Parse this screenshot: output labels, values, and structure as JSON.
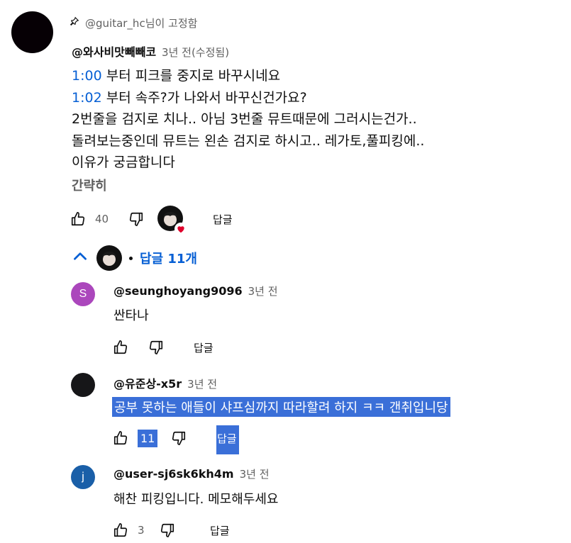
{
  "pinned": {
    "label": "@guitar_hc님이 고정함",
    "icon": "pin-icon"
  },
  "main_comment": {
    "author": "@와사비맛빼빼코",
    "time": "3년 전(수정됨)",
    "lines": [
      {
        "timestamp": "1:00",
        "text": " 부터 피크를 중지로 바꾸시네요"
      },
      {
        "timestamp": "1:02",
        "text": " 부터 속주?가 나와서 바꾸신건가요?"
      },
      {
        "timestamp": "",
        "text": "2번줄을 검지로 치나.. 아님 3번줄 뮤트때문에 그러시는건가.."
      },
      {
        "timestamp": "",
        "text": "돌려보는중인데 뮤트는 왼손 검지로 하시고.. 레가토,풀피킹에.."
      },
      {
        "timestamp": "",
        "text": "이유가 궁금합니다"
      }
    ],
    "collapse_label": "간략히",
    "likes": "40",
    "reply_label": "답글",
    "avatar_color": "#060005"
  },
  "replies_toggle": {
    "label": "답글 11개",
    "color": "#065fd4"
  },
  "replies": [
    {
      "author": "@seunghoyang9096",
      "time": "3년 전",
      "text": "싼타나",
      "likes": "",
      "reply_label": "답글",
      "avatar_letter": "S",
      "avatar_color": "#ab47bc"
    },
    {
      "author": "@유준상-x5r",
      "time": "3년 전",
      "text": "공부 못하는 애들이 샤프심까지 따라할려 하지 ㅋㅋ 갠취입니당",
      "likes": "11",
      "reply_label": "답글",
      "avatar_letter": "",
      "avatar_color": "#161618"
    },
    {
      "author": "@user-sj6sk6kh4m",
      "time": "3년 전",
      "text": "해찬 피킹입니다. 메모해두세요",
      "likes": "3",
      "reply_label": "답글",
      "avatar_letter": "j",
      "avatar_color": "#1a5fa8"
    }
  ]
}
